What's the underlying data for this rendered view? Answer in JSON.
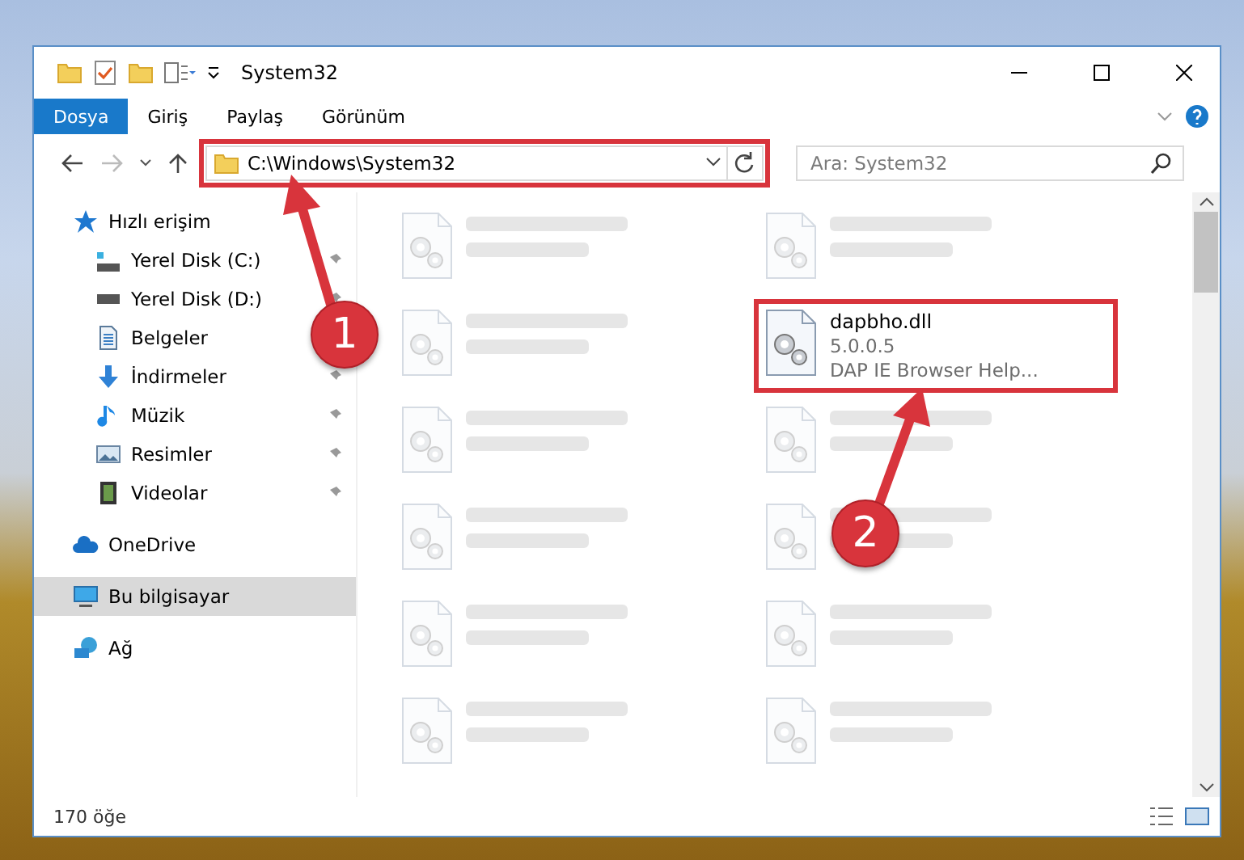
{
  "window": {
    "title": "System32"
  },
  "ribbon_tabs": [
    {
      "label": "Dosya",
      "selected": true
    },
    {
      "label": "Giriş",
      "selected": false
    },
    {
      "label": "Paylaş",
      "selected": false
    },
    {
      "label": "Görünüm",
      "selected": false
    }
  ],
  "address_bar": {
    "path": "C:\\Windows\\System32",
    "annotated": true
  },
  "search": {
    "placeholder": "Ara: System32"
  },
  "sidebar": {
    "items": [
      {
        "label": "Hızlı erişim",
        "kind": "star",
        "selected": false,
        "children": [
          {
            "label": "Yerel Disk (C:)",
            "kind": "drive-c",
            "pinned": true,
            "selected": false
          },
          {
            "label": "Yerel Disk (D:)",
            "kind": "drive",
            "pinned": true,
            "selected": false
          },
          {
            "label": "Belgeler",
            "kind": "docs",
            "pinned": false,
            "selected": false
          },
          {
            "label": "İndirmeler",
            "kind": "download",
            "pinned": true,
            "selected": false
          },
          {
            "label": "Müzik",
            "kind": "music",
            "pinned": true,
            "selected": false
          },
          {
            "label": "Resimler",
            "kind": "pictures",
            "pinned": true,
            "selected": false
          },
          {
            "label": "Videolar",
            "kind": "videos",
            "pinned": true,
            "selected": false
          }
        ]
      },
      {
        "label": "OneDrive",
        "kind": "cloud",
        "selected": false
      },
      {
        "label": "Bu bilgisayar",
        "kind": "pc",
        "selected": true
      },
      {
        "label": "Ağ",
        "kind": "network",
        "selected": false
      }
    ]
  },
  "files": [
    {
      "kind": "blurred"
    },
    {
      "kind": "blurred"
    },
    {
      "kind": "blurred"
    },
    {
      "kind": "file",
      "name": "dapbho.dll",
      "lines": [
        "5.0.0.5",
        "DAP IE Browser Help..."
      ],
      "annotated": true
    },
    {
      "kind": "blurred"
    },
    {
      "kind": "blurred"
    },
    {
      "kind": "blurred"
    },
    {
      "kind": "blurred"
    },
    {
      "kind": "blurred"
    },
    {
      "kind": "blurred"
    },
    {
      "kind": "blurred"
    },
    {
      "kind": "blurred"
    }
  ],
  "status_bar": {
    "count": "170 öğe"
  },
  "callouts": [
    {
      "number": "1"
    },
    {
      "number": "2"
    }
  ]
}
